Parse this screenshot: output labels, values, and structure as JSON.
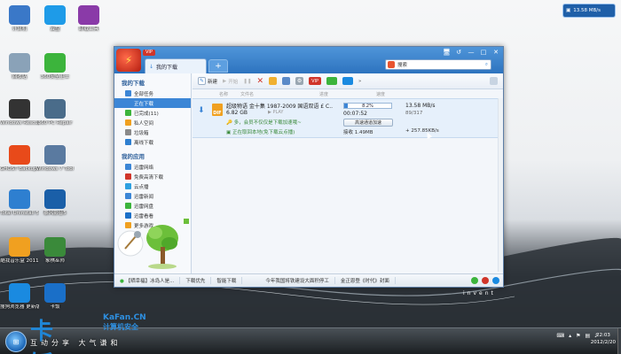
{
  "desktop": {
    "icons": [
      {
        "label": "计算机",
        "icon": "computer-icon",
        "color": "#3a78c8"
      },
      {
        "label": "云盘",
        "icon": "cloud-icon",
        "color": "#1e9be8"
      },
      {
        "label": "卸载工具",
        "icon": "rar-icon",
        "color": "#8a3aa8"
      },
      {
        "label": "回收站",
        "icon": "recycle-bin-icon",
        "color": "#8aa2b8"
      },
      {
        "label": "360安全卫士",
        "icon": "shield-plus-icon",
        "color": "#3cb43c"
      },
      {
        "label": "Windows Rescue",
        "icon": "camera-icon",
        "color": "#333333"
      },
      {
        "label": "360 PC Repair",
        "icon": "wrench-icon",
        "color": "#4a6c8a"
      },
      {
        "label": "GHOST Backup Pro",
        "icon": "ghost-icon",
        "color": "#e84a1a"
      },
      {
        "label": "Windows 7 Tool",
        "icon": "tools-icon",
        "color": "#5a7aa0"
      },
      {
        "label": "Total Uninstall 5",
        "icon": "uninstall-icon",
        "color": "#2e7fd0"
      },
      {
        "label": "暴风影音5",
        "icon": "media-player-icon",
        "color": "#1a5fa8"
      },
      {
        "label": "酷我音乐盒 2011",
        "icon": "music-icon",
        "color": "#f0a020"
      },
      {
        "label": "象棋巫师",
        "icon": "chess-icon",
        "color": "#3a8a3a"
      },
      {
        "label": "搜狗浏览器 更新版",
        "icon": "sogou-browser-icon",
        "color": "#1a8ae0"
      },
      {
        "label": "卡饭",
        "icon": "plane-icon",
        "color": "#1a6fc8"
      }
    ]
  },
  "widget": {
    "text": "13.58 MB/s",
    "icon": "speed-icon"
  },
  "window": {
    "logo_text": "VIP",
    "vip_label": "VIP",
    "tab_label": "我的下载",
    "tab_add": "+",
    "search_placeholder": "搜索",
    "controls": [
      "🖥",
      "↺",
      "—",
      "□",
      "✕"
    ]
  },
  "sidebar": {
    "section_downloads": "我的下载",
    "download_items": [
      {
        "label": "全部任务",
        "color": "#3c86d6"
      },
      {
        "label": "正在下载",
        "color": "#3c86d6",
        "active": true
      },
      {
        "label": "已完成(11)",
        "color": "#3cb43c"
      },
      {
        "label": "私人空间",
        "color": "#f0a020"
      },
      {
        "label": "垃圾箱",
        "color": "#8a8a8a"
      },
      {
        "label": "离线下载",
        "color": "#2e7fd0"
      }
    ],
    "section_apps": "我的应用",
    "app_items": [
      {
        "label": "迅雷网络",
        "color": "#3c86d6"
      },
      {
        "label": "免费高清下载",
        "color": "#d0352a"
      },
      {
        "label": "云点播",
        "color": "#2ea0e0"
      },
      {
        "label": "迅雷新闻",
        "color": "#3c86d6"
      },
      {
        "label": "迅雷网盘",
        "color": "#3cb43c"
      },
      {
        "label": "迅雷看看",
        "color": "#1a6fc8"
      },
      {
        "label": "更多游戏",
        "color": "#f0a020"
      }
    ]
  },
  "toolbar": {
    "new": "新建",
    "start": "开始",
    "pause": "暂停",
    "delete": "删除",
    "vip_label": "VIP",
    "more": "»"
  },
  "columns": [
    "名称",
    "文件名",
    "进度",
    "速度"
  ],
  "task": {
    "file_type": "DIF",
    "name": "超级物语 金十集 1987-2009 国语双语 £ C...",
    "size": "6.82 GB",
    "play": "PLAY",
    "progress": 0.082,
    "progress_text": "8.2%",
    "time_left": "00:07:52",
    "speed": "13.58 MB/s",
    "peers": "89/317",
    "tip": "多，会员不仅仅是下载加速哦~",
    "accel_button": "高速通道加速",
    "cloud_status": "正在取回本地(免下载云点播)",
    "received": "接收 1.49MB",
    "extra_speed": "+ 257.85KB/s"
  },
  "statusbar": {
    "news": "【晒幸福】冰岛人是...",
    "item2": "下载优先",
    "item3": "智能下载",
    "item4": "今年我国将铁建设大面积停工",
    "item5": "金正恩登《时代》封面"
  },
  "invent_text": "invent",
  "taskbar": {
    "start": "⊞",
    "time": "22:03",
    "date": "2012/2/20"
  },
  "watermark": {
    "big": "卡饭",
    "top": "KaFan.CN",
    "mid": "计算机安全",
    "bottom": "互动分享 大气谦和"
  }
}
